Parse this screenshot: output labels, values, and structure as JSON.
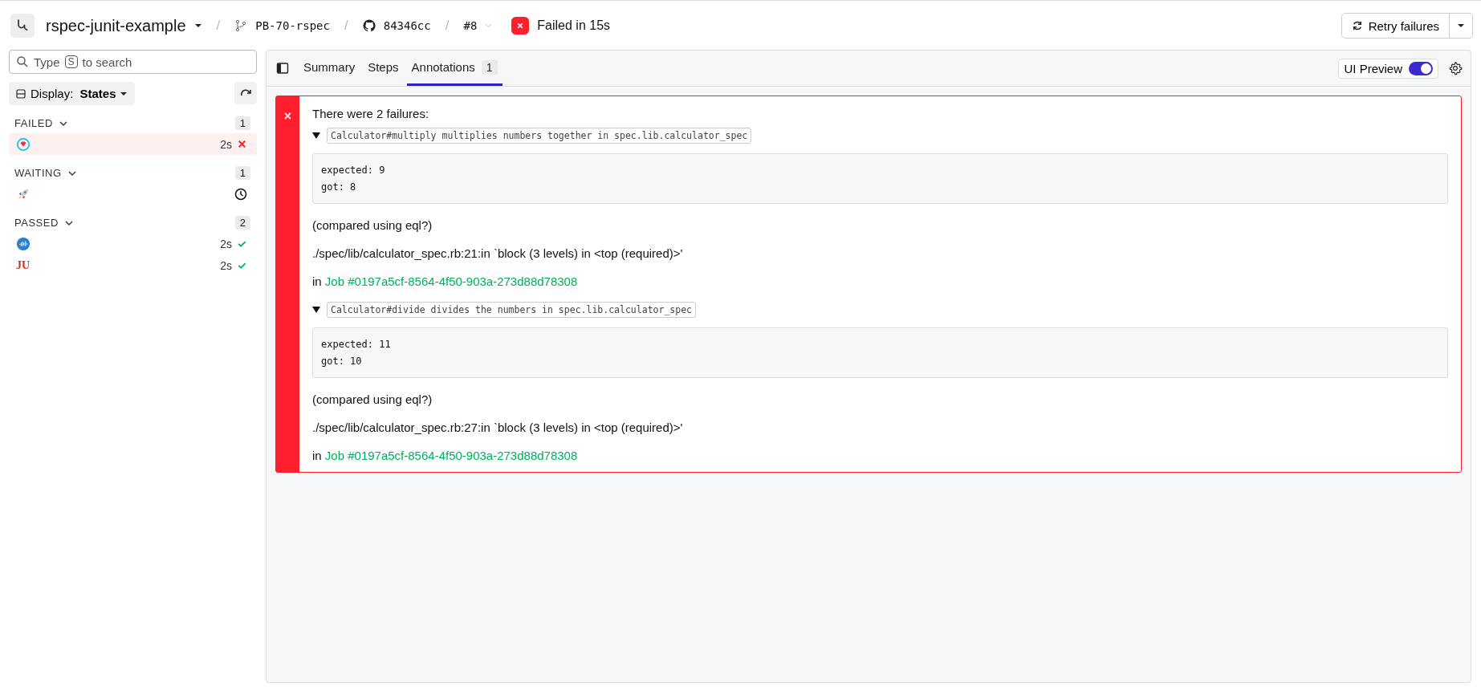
{
  "header": {
    "pipeline": "rspec-junit-example",
    "branch": "PB-70-rspec",
    "commit": "84346cc",
    "build": "#8",
    "separator": "/",
    "failed": true,
    "status_text": "Failed in 15s",
    "retry_button": "Retry failures"
  },
  "sidebar": {
    "search": {
      "hint_before": "Type",
      "shortcut_key": "S",
      "hint_after": "to search"
    },
    "display_label": "Display:",
    "display_value": "States",
    "groups": [
      {
        "kind": "failed",
        "title": "FAILED",
        "count": "1",
        "expanded": true,
        "items": [
          {
            "kind": "gem",
            "duration": "2s",
            "selected": true
          }
        ]
      },
      {
        "kind": "waiting",
        "title": "WAITING",
        "count": "1",
        "expanded": true,
        "items": [
          {
            "kind": "rocket",
            "selected": false
          }
        ]
      },
      {
        "kind": "passed",
        "title": "PASSED",
        "count": "2",
        "expanded": true,
        "items": [
          {
            "kind": "wave",
            "duration": "2s",
            "selected": false
          },
          {
            "kind": "letters",
            "logo_text": "JU",
            "duration": "2s",
            "selected": false
          }
        ]
      }
    ]
  },
  "tabs": [
    {
      "label": "Summary",
      "selected": false
    },
    {
      "label": "Steps",
      "selected": false
    },
    {
      "label": "Annotations",
      "count": "1",
      "selected": true
    }
  ],
  "ui_preview": {
    "label": "UI Preview",
    "on": true
  },
  "annotation": {
    "kind": "error",
    "mark": "×",
    "heading": "There were 2 failures:",
    "failures": [
      {
        "name": "Calculator#multiply multiplies numbers together in spec.lib.calculator_spec",
        "expanded": true,
        "output": [
          "expected: 9",
          "got: 8"
        ],
        "note": "(compared using eql?)",
        "location": "./spec/lib/calculator_spec.rb:21:in `block (3 levels) in <top (required)>'",
        "job_prefix": "in",
        "job_link": "Job #0197a5cf-8564-4f50-903a-273d88d78308"
      },
      {
        "name": "Calculator#divide divides the numbers in spec.lib.calculator_spec",
        "expanded": true,
        "output": [
          "expected: 11",
          "got: 10"
        ],
        "note": "(compared using eql?)",
        "location": "./spec/lib/calculator_spec.rb:27:in `block (3 levels) in <top (required)>'",
        "job_prefix": "in",
        "job_link": "Job #0197a5cf-8564-4f50-903a-273d88d78308"
      }
    ]
  }
}
